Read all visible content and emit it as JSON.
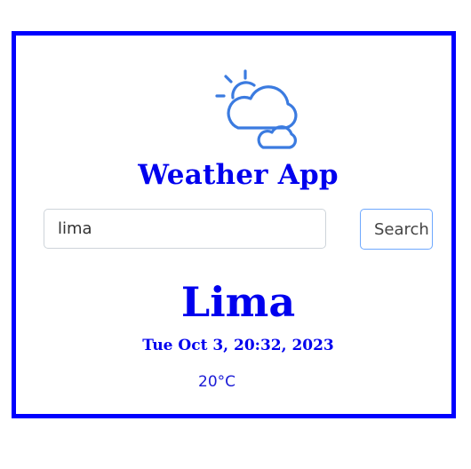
{
  "header": {
    "app_title": "Weather App",
    "logo_icon": "sun-behind-clouds-icon"
  },
  "search": {
    "value": "lima",
    "placeholder": "",
    "button_label": "Search"
  },
  "weather": {
    "city": "Lima",
    "datetime": "Tue Oct 3, 20:32, 2023",
    "temperature": "20°C"
  },
  "colors": {
    "frame_border": "#0000ff",
    "title_text": "#0000ee",
    "icon_stroke": "#3b7be0",
    "button_border": "#6ea8fe"
  }
}
